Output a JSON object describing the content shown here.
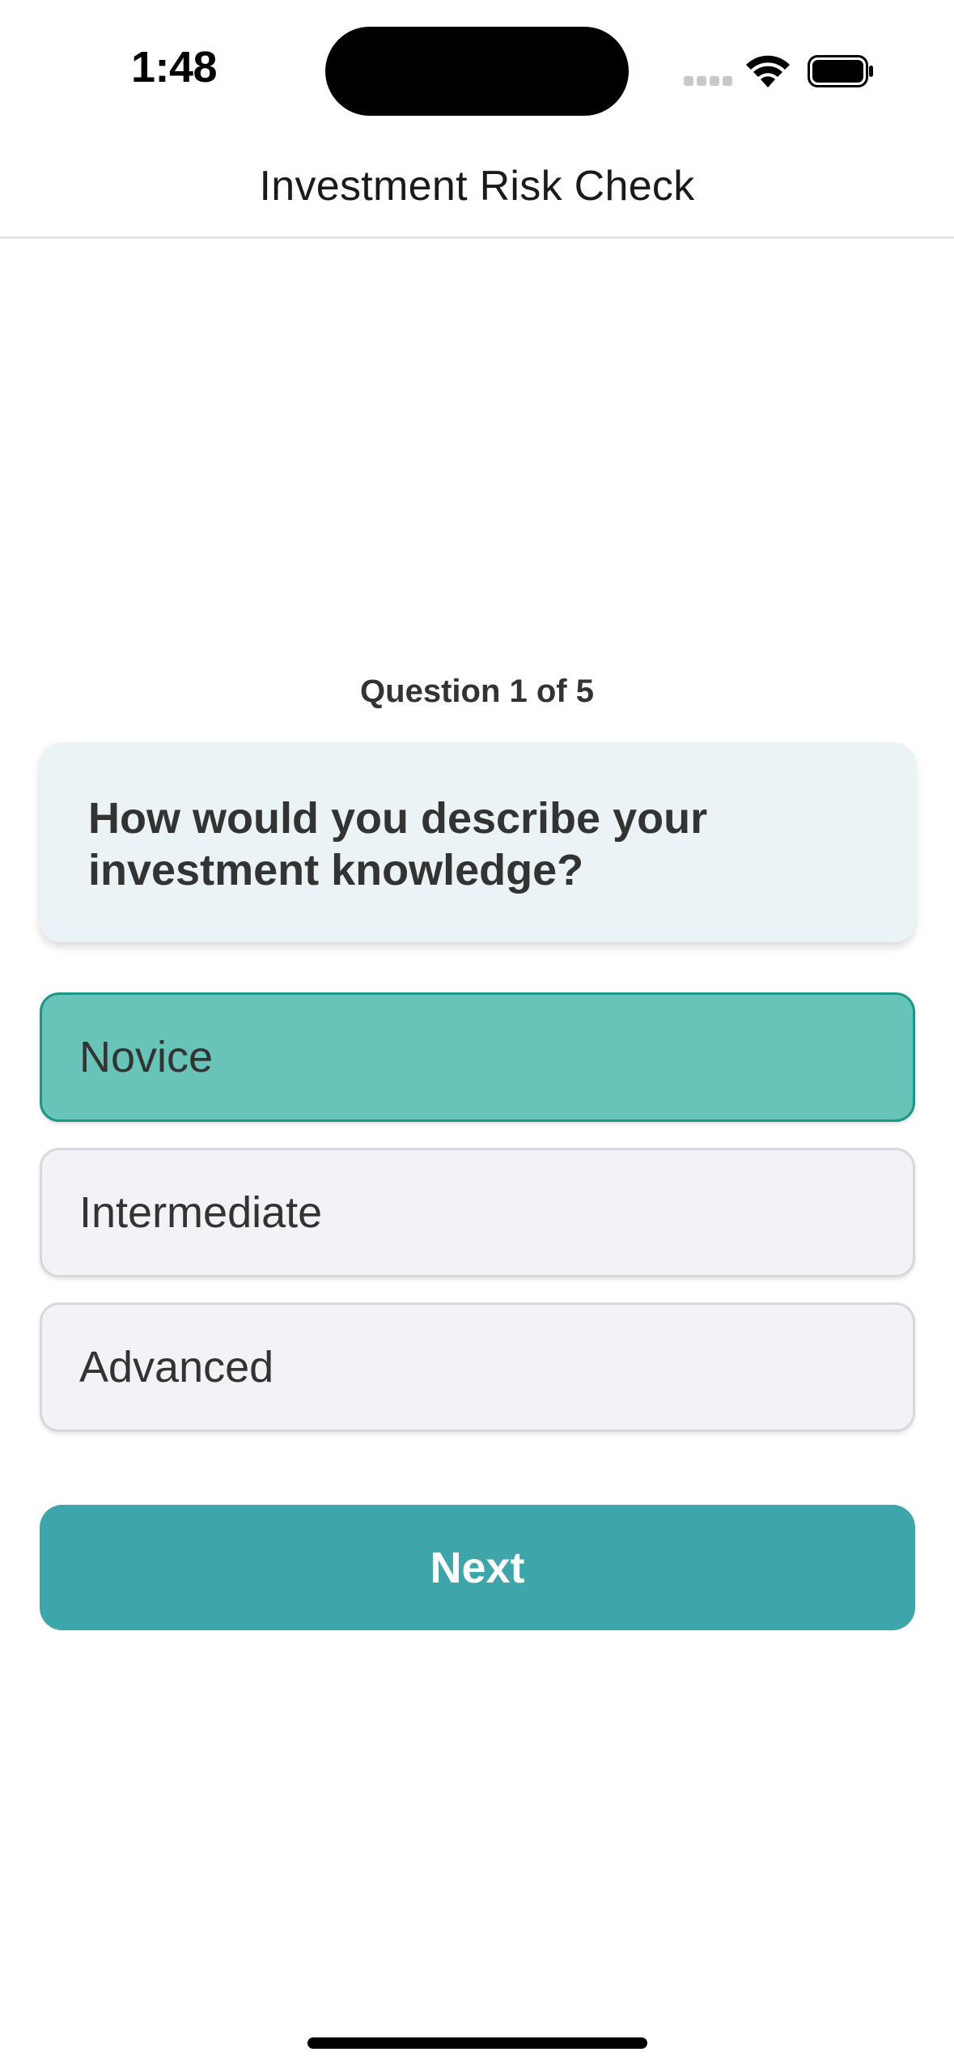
{
  "status_bar": {
    "time": "1:48",
    "icons": [
      "cellular-signal-icon",
      "wifi-icon",
      "battery-icon"
    ]
  },
  "nav": {
    "title": "Investment Risk Check"
  },
  "quiz": {
    "counter": "Question 1 of 5",
    "question": "How would you describe your investment knowledge?",
    "options": [
      {
        "label": "Novice",
        "selected": true
      },
      {
        "label": "Intermediate",
        "selected": false
      },
      {
        "label": "Advanced",
        "selected": false
      }
    ],
    "next_label": "Next"
  },
  "colors": {
    "accent": "#3ea5aa",
    "selected_fill": "#68c3b8",
    "selected_border": "#1d9688",
    "card_bg": "#ebf3f6",
    "option_bg": "#f2f2f7"
  }
}
